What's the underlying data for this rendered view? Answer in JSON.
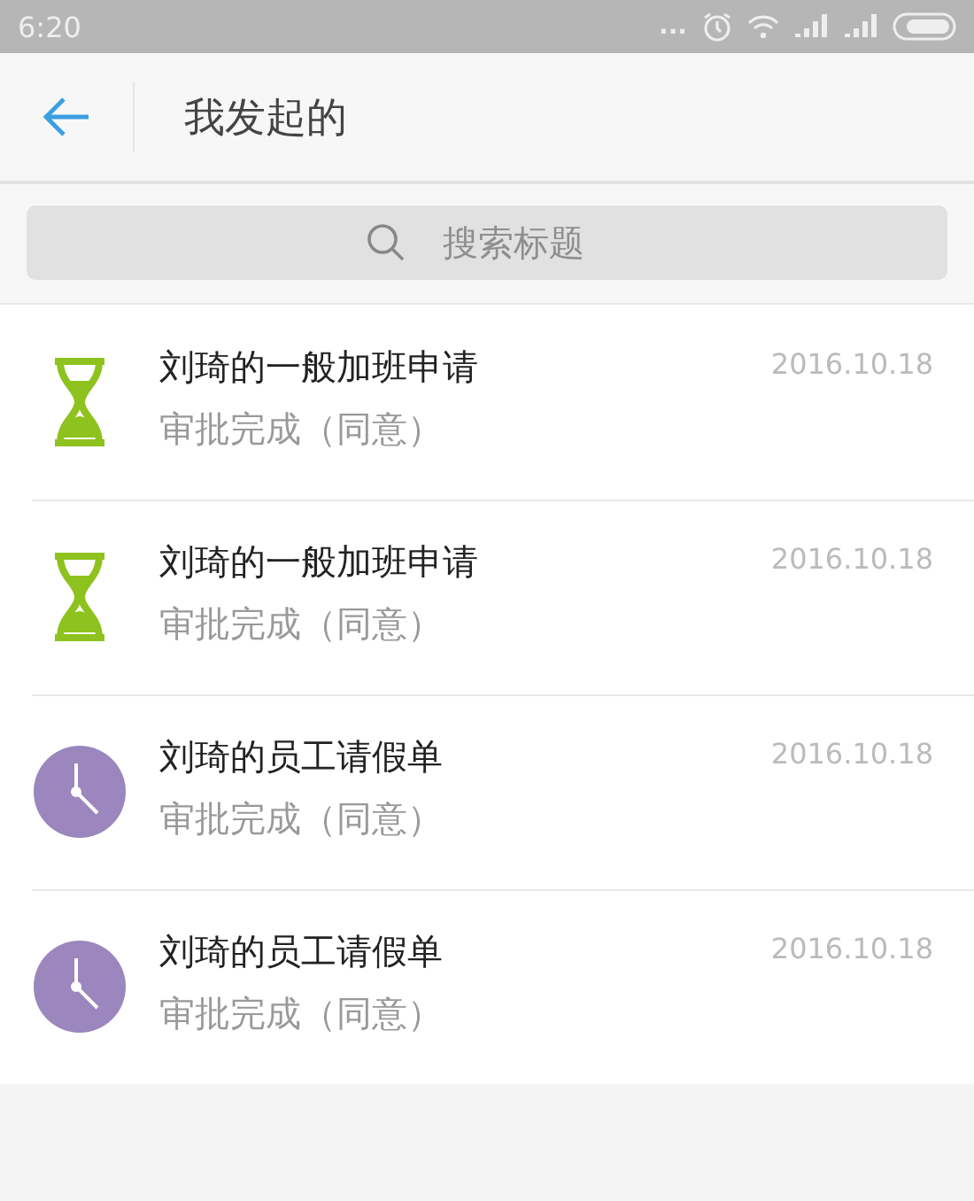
{
  "status_bar": {
    "time": "6:20",
    "dots": "..."
  },
  "header": {
    "title": "我发起的"
  },
  "search": {
    "placeholder": "搜索标题"
  },
  "items": [
    {
      "kind": "overtime",
      "title": "刘琦的一般加班申请",
      "status": "审批完成（同意）",
      "date": "2016.10.18"
    },
    {
      "kind": "overtime",
      "title": "刘琦的一般加班申请",
      "status": "审批完成（同意）",
      "date": "2016.10.18"
    },
    {
      "kind": "leave",
      "title": "刘琦的员工请假单",
      "status": "审批完成（同意）",
      "date": "2016.10.18"
    },
    {
      "kind": "leave",
      "title": "刘琦的员工请假单",
      "status": "审批完成（同意）",
      "date": "2016.10.18"
    }
  ]
}
